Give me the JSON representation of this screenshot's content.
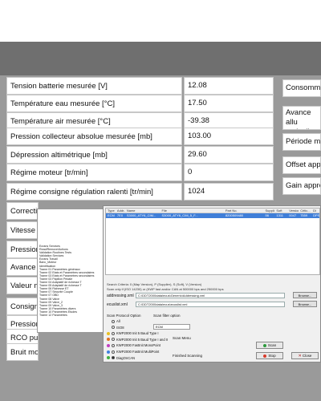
{
  "params": [
    {
      "label": "Tension batterie mesurée [V]",
      "value": "12.08"
    },
    {
      "label": "Température eau mesurée [°C]",
      "value": "17.50"
    },
    {
      "label": "Température air mesurée [°C]",
      "value": "-39.38"
    },
    {
      "label": "Pression collecteur absolue mesurée [mb]",
      "value": "103.00"
    },
    {
      "label": "Dépression altimétrique [mb]",
      "value": "29.60"
    },
    {
      "label": "Régime moteur [tr/min]",
      "value": "0"
    },
    {
      "label": "Régime consigne régulation ralenti [tr/min]",
      "value": "1024"
    },
    {
      "label": "Correctio",
      "value": ""
    },
    {
      "label": "Vitesse v",
      "value": ""
    },
    {
      "label": "Pression",
      "value": ""
    },
    {
      "label": "Avance a",
      "value": ""
    },
    {
      "label": "Valeur m",
      "value": ""
    },
    {
      "label": "Consigne",
      "value": ""
    },
    {
      "label": "Pression",
      "value": ""
    },
    {
      "label": "RCO purg",
      "value": ""
    },
    {
      "label": "Bruit moto",
      "value": ""
    }
  ],
  "right_params": [
    "Consommat",
    "Avance allu anti_cliquet",
    "Période moy",
    "Offset appr",
    "Gain appren"
  ],
  "tree": [
    "Ecrans Services",
    "  Read/Remove/Actions",
    "  Validation Routines Tests",
    "  Validation Services",
    "Ecrans Travail",
    "  Banc_Moteur",
    "  Identification",
    "Trame 01 Paramètres généraux",
    "Trame 02 Etats et Paramètres secondaires",
    "Trame 03 Etats et Paramètres secondaires",
    "Trame 03 Papillon Pédale",
    "Trame 04 Adaptatif de richesse T",
    "Trame 05 Adaptatif de richesse T",
    "Trame 06 Richesse ET",
    "Trame 07 Sécurité Couple",
    "Trame 07 OBD",
    "Trame 08 Valve",
    "Trame 09 Valve_2",
    "Trame 09 Valve_3",
    "Trame 10 Paramètres divers",
    "Trame 10 Paramètres Etudes",
    "Trame 12 Paramètres"
  ],
  "dialog": {
    "columns": [
      "Type",
      "Addr...",
      "Name",
      "File",
      "Part No.",
      "Supplier",
      "Soft",
      "Version",
      "Critic...",
      "Di"
    ],
    "selected_row": [
      "ECM",
      "7E0",
      "S3000_ATY6_CIM...",
      "S3000_ATY6_CIM_5_F...",
      "8200509480",
      "56",
      "1311",
      "0047",
      "7559",
      "DPS"
    ],
    "info1": "Search Criteria: 0 (Map Version), P (Supplier), S (Soft), V (Version)",
    "info2": "Scan only if (ISO 14230) or (KWP fast and/or CAN at 500000 bps and 250000 bps",
    "addressing_label": "addressing.xml",
    "addressing_value": "C:\\DDT2000data\\ecus\\Generic\\Addressing.xml",
    "ecuslist_label": "ecuslist.xml",
    "ecuslist_value": "C:\\DDT2000data\\ecus\\ecuslist.xml",
    "browse_label": "Browse...",
    "scan_protocol_title": "Scan Protocol Option",
    "scan_menu_title": "Scan Menu",
    "options": [
      {
        "label": "All",
        "dot_color": "",
        "selected": false
      },
      {
        "label": "ISO8",
        "dot_color": "",
        "selected": false
      },
      {
        "label": "KWP2000 Init 5 Baud Type I",
        "dot_color": "#e8c020",
        "selected": false
      },
      {
        "label": "KWP2000 Init 5 Baud Type I and II",
        "dot_color": "#e07020",
        "selected": false
      },
      {
        "label": "KWP2000 FastInit MonoPoint",
        "dot_color": "#c040c0",
        "selected": false
      },
      {
        "label": "KWP2000 FastInit MultiPoint",
        "dot_color": "#4080e0",
        "selected": false
      },
      {
        "label": "DiagOnCAN",
        "dot_color": "#40b040",
        "selected": true
      }
    ],
    "scan_filter_title": "Scan filter option",
    "scan_filter_value": "ECM",
    "status": "Finished Scanning",
    "scan_label": "Scan",
    "stop_label": "Stop",
    "close_label": "Close"
  }
}
